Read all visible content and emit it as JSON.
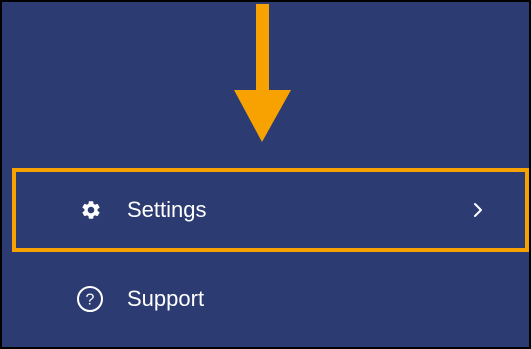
{
  "menu": {
    "items": [
      {
        "label": "Settings",
        "icon": "gear-icon",
        "has_submenu": true,
        "highlighted": true
      },
      {
        "label": "Support",
        "icon": "question-circle-icon",
        "has_submenu": false,
        "highlighted": false
      }
    ]
  },
  "colors": {
    "sidebar_background": "#2c3c72",
    "highlight": "#f7a200",
    "text": "#ffffff",
    "border": "#000000"
  }
}
